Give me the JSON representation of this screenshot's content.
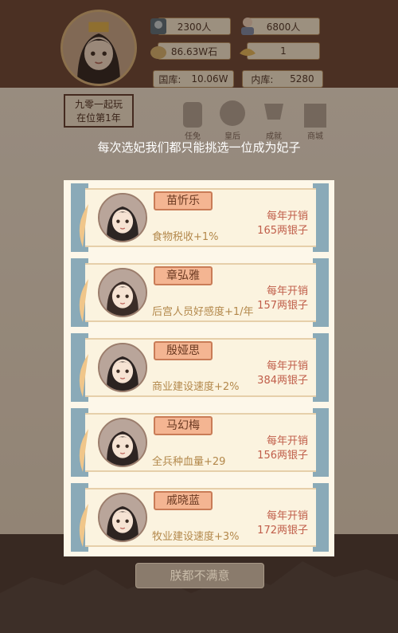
{
  "header": {
    "soldiers": "2300人",
    "population": "6800人",
    "grain": "86.63W石",
    "grain_prefix_icon": "grain-icon",
    "gold_count": "1",
    "treasury_label": "国库:",
    "treasury_value": "10.06W",
    "court_label": "内库:",
    "court_value": "5280",
    "emperor_title_line1": "九零一起玩",
    "emperor_title_line2": "在位第1年"
  },
  "menu": {
    "items": [
      {
        "label": "任免",
        "icon": "official-icon"
      },
      {
        "label": "皇后",
        "icon": "empress-icon"
      },
      {
        "label": "成就",
        "icon": "achievement-icon"
      },
      {
        "label": "商城",
        "icon": "shop-icon"
      }
    ]
  },
  "dialog": {
    "prompt": "每次选妃我们都只能挑选一位成为妃子",
    "cards": [
      {
        "name": "苗忻乐",
        "bonus": "食物税收+1%",
        "cost_label": "每年开销",
        "cost_value": "165两银子"
      },
      {
        "name": "章弘雅",
        "bonus": "后宫人员好感度+1/年",
        "cost_label": "每年开销",
        "cost_value": "157两银子"
      },
      {
        "name": "殷娅思",
        "bonus": "商业建设速度+2%",
        "cost_label": "每年开销",
        "cost_value": "384两银子"
      },
      {
        "name": "马幻梅",
        "bonus": "全兵种血量+29",
        "cost_label": "每年开销",
        "cost_value": "156两银子"
      },
      {
        "name": "戚晓蓝",
        "bonus": "牧业建设速度+3%",
        "cost_label": "每年开销",
        "cost_value": "172两银子"
      }
    ],
    "dismiss_button": "朕都不满意"
  },
  "colors": {
    "accent": "#f4b592",
    "cost": "#c05e4a",
    "bonus": "#b3884b",
    "ribbon": "#8aaab8"
  }
}
